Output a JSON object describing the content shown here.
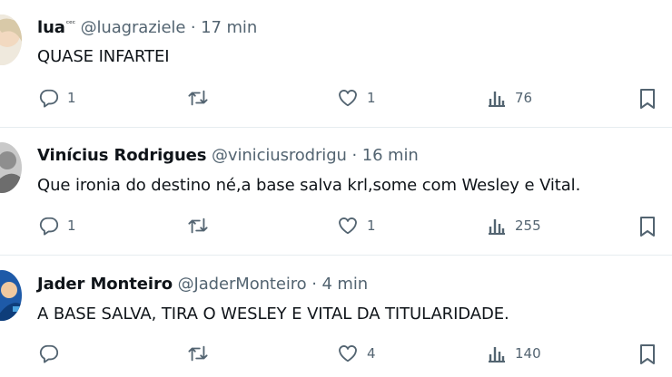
{
  "tweets": [
    {
      "name": "lua",
      "name_sup": "ᶜᵉᶜ",
      "handle": "@luagraziele",
      "dot": "·",
      "time": "17 min",
      "text": "QUASE INFARTEI",
      "replies": "1",
      "retweets": "",
      "likes": "1",
      "views": "76"
    },
    {
      "name": "Vinícius Rodrigues",
      "handle": "@viniciusrodrigu",
      "dot": "·",
      "time": "16 min",
      "text": "Que ironia do destino né,a base salva krl,some com Wesley e Vital.",
      "replies": "1",
      "retweets": "",
      "likes": "1",
      "views": "255"
    },
    {
      "name": "Jader Monteiro",
      "handle": "@JaderMonteiro",
      "dot": "·",
      "time": "4 min",
      "text": "A BASE SALVA, TIRA O WESLEY E VITAL DA TITULARIDADE.",
      "replies": "",
      "retweets": "",
      "likes": "4",
      "views": "140"
    }
  ],
  "icons": {
    "reply": "reply-icon",
    "retweet": "retweet-icon",
    "like": "heart-icon",
    "views": "views-icon",
    "bookmark": "bookmark-icon"
  },
  "colors": {
    "text": "#0f1419",
    "secondary": "#536471",
    "divider": "#e6ecf0"
  }
}
